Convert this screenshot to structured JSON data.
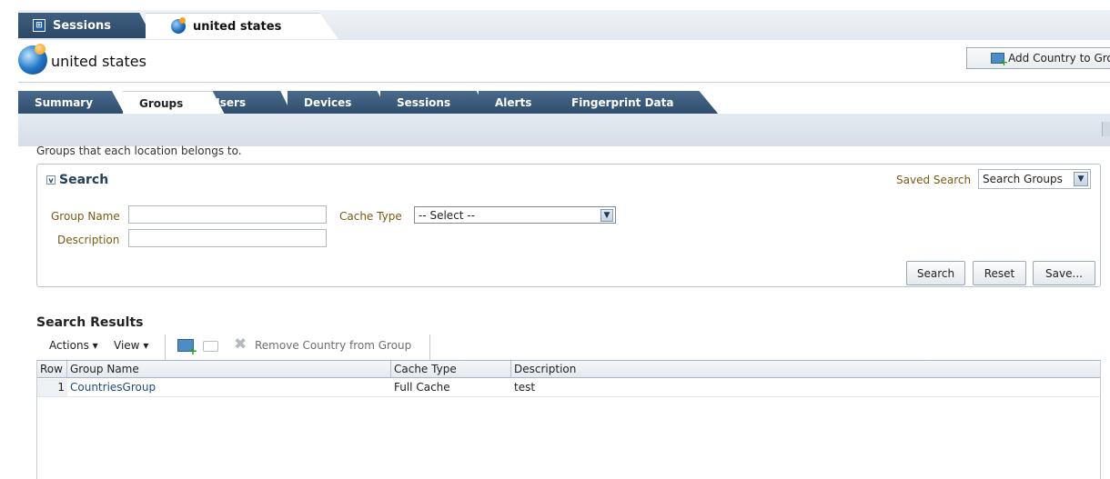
{
  "top_tabs": [
    {
      "label": "Sessions"
    },
    {
      "label": "united states"
    }
  ],
  "header": {
    "title": "united states",
    "add_button": "Add Country to Group"
  },
  "tabs": [
    {
      "label": "Summary"
    },
    {
      "label": "Groups",
      "active": true
    },
    {
      "label": "Users"
    },
    {
      "label": "Devices"
    },
    {
      "label": "Sessions"
    },
    {
      "label": "Alerts"
    },
    {
      "label": "Fingerprint Data"
    }
  ],
  "description": "Groups that each location belongs to.",
  "search": {
    "title": "Search",
    "saved_search_label": "Saved Search",
    "saved_search_value": "Search Groups",
    "group_name_label": "Group Name",
    "group_name_value": "",
    "description_label": "Description",
    "description_value": "",
    "cache_type_label": "Cache Type",
    "cache_type_value": "-- Select --",
    "buttons": {
      "search": "Search",
      "reset": "Reset",
      "save": "Save..."
    }
  },
  "results": {
    "title": "Search Results",
    "actions_label": "Actions",
    "view_label": "View",
    "remove_label": "Remove Country from Group",
    "columns": [
      "Row",
      "Group Name",
      "Cache Type",
      "Description"
    ],
    "rows": [
      {
        "row": "1",
        "group_name": "CountriesGroup",
        "cache_type": "Full Cache",
        "description": "test"
      }
    ]
  },
  "icons": {
    "sessions_tab": "monitor-icon",
    "location": "globe-icon",
    "add": "add-to-group-icon",
    "remove": "remove-x-icon"
  },
  "colors": {
    "tab_dark": "#2e4c6c",
    "label_brown": "#7a5a14",
    "link_blue": "#1f4a84"
  }
}
